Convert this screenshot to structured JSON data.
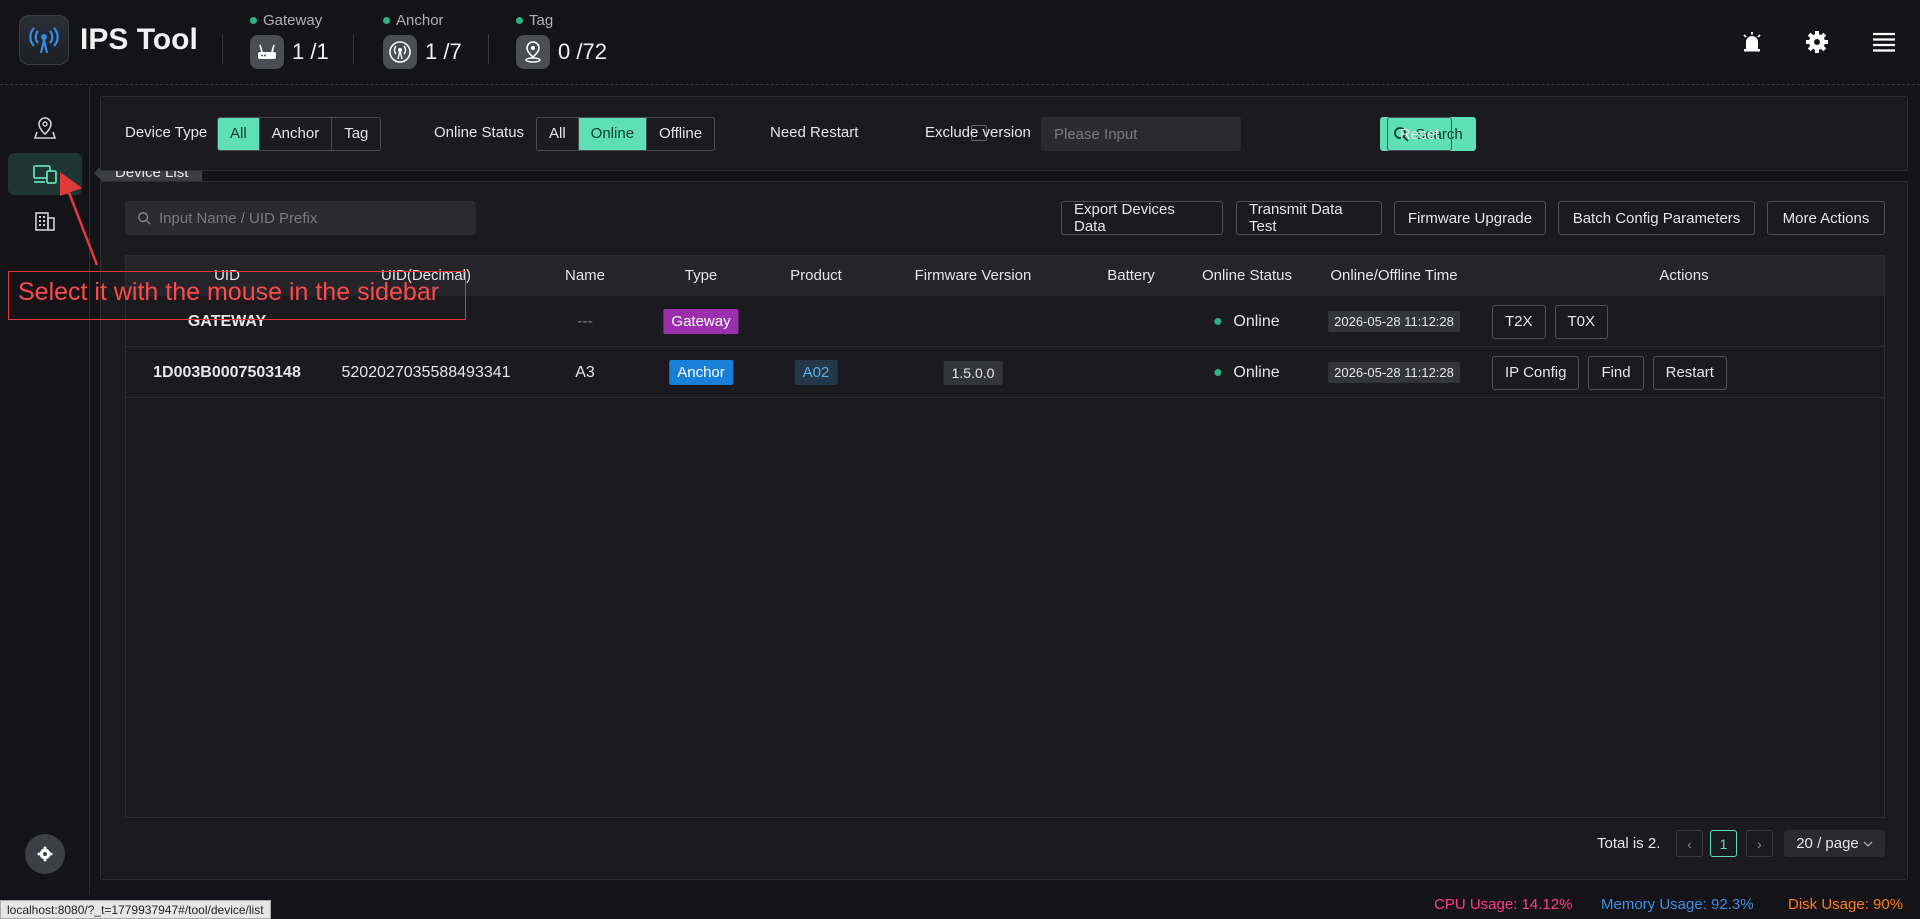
{
  "header": {
    "title": "IPS Tool",
    "stats": [
      {
        "label": "Gateway",
        "value": "1 /1"
      },
      {
        "label": "Anchor",
        "value": "1 /7"
      },
      {
        "label": "Tag",
        "value": "0 /72"
      }
    ]
  },
  "sidebar": {
    "tooltip": "Device List"
  },
  "filters": {
    "device_type_label": "Device Type",
    "device_type_options": [
      "All",
      "Anchor",
      "Tag"
    ],
    "device_type_selected": "All",
    "online_status_label": "Online Status",
    "online_status_options": [
      "All",
      "Online",
      "Offline"
    ],
    "online_status_selected": "Online",
    "need_restart_label": "Need Restart",
    "exclude_version_label": "Exclude version",
    "exclude_version_placeholder": "Please Input",
    "search_label": "Search",
    "reset_label": "Reset"
  },
  "toolbar": {
    "search_placeholder": "Input Name / UID Prefix",
    "buttons": [
      "Export Devices Data",
      "Transmit Data Test",
      "Firmware Upgrade",
      "Batch Config Parameters",
      "More Actions"
    ]
  },
  "table": {
    "columns": [
      "UID",
      "UID(Decimal)",
      "Name",
      "Type",
      "Product",
      "Firmware Version",
      "Battery",
      "Online Status",
      "Online/Offline Time",
      "Actions"
    ],
    "rows": [
      {
        "uid": "GATEWAY",
        "uid_decimal": "",
        "name": "---",
        "type": "Gateway",
        "product": "",
        "firmware": "",
        "battery": "",
        "status": "Online",
        "time": "2026-05-28 11:12:28",
        "actions": [
          "T2X",
          "T0X"
        ]
      },
      {
        "uid": "1D003B0007503148",
        "uid_decimal": "5202027035588493341",
        "name": "A3",
        "type": "Anchor",
        "product": "A02",
        "firmware": "1.5.0.0",
        "battery": "",
        "status": "Online",
        "time": "2026-05-28 11:12:28",
        "actions": [
          "IP Config",
          "Find",
          "Restart"
        ]
      }
    ]
  },
  "pagination": {
    "total_text": "Total is 2.",
    "current_page": "1",
    "page_size": "20 / page"
  },
  "annotation": {
    "text": "Select it with the mouse in the sidebar"
  },
  "statusbar": {
    "url": "localhost:8080/?_t=1779937947#/tool/device/list",
    "cpu": "CPU Usage:  14.12%",
    "memory": "Memory Usage:  92.3%",
    "disk": "Disk Usage:  90%"
  },
  "colors": {
    "accent": "#5fe0b4",
    "gateway_tag": "#9b2fae",
    "anchor_tag": "#1a7fd6",
    "cpu": "#ff3d7f",
    "memory": "#3b8fe8",
    "disk": "#ff7a1a"
  }
}
